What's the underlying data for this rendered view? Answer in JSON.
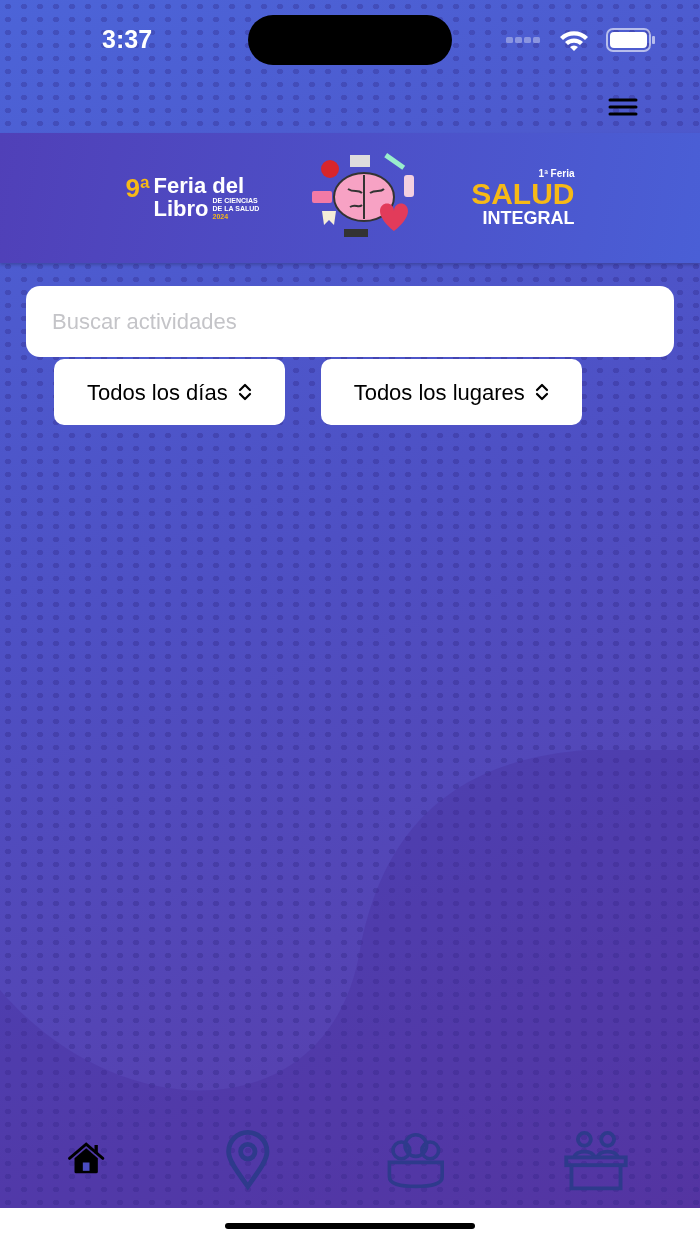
{
  "status_bar": {
    "time": "3:37"
  },
  "banner": {
    "left_logo": {
      "number": "9ª",
      "line_1": "Feria del",
      "line_2": "Libro",
      "subtitle_1": "DE CIENCIAS",
      "subtitle_2": "DE LA SALUD",
      "year": "2024"
    },
    "right_logo": {
      "kicker": "1ª Feria",
      "title": "SALUD",
      "subtitle": "INTEGRAL"
    }
  },
  "search": {
    "placeholder": "Buscar actividades"
  },
  "filters": [
    {
      "label": "Todos los días"
    },
    {
      "label": "Todos los lugares"
    }
  ],
  "tab_bar": [
    {
      "kind": "home",
      "selected": true
    },
    {
      "kind": "location",
      "selected": false
    },
    {
      "kind": "group",
      "selected": false
    },
    {
      "kind": "desk",
      "selected": false
    }
  ]
}
